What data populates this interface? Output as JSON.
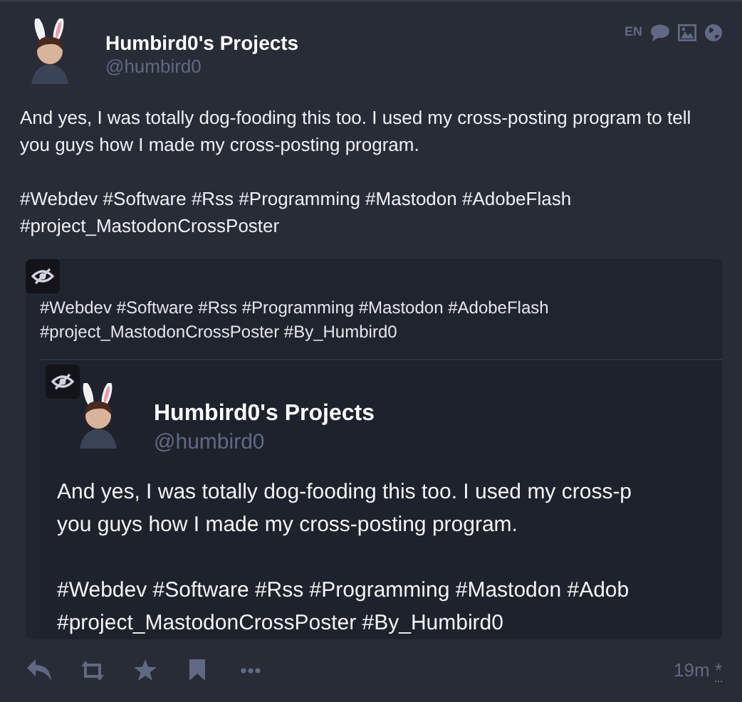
{
  "post": {
    "author": {
      "display_name": "Humbird0's Projects",
      "handle": "@humbird0"
    },
    "meta": {
      "language": "EN"
    },
    "body": [
      "And yes, I was totally dog-fooding this too. I used my cross-posting program to tell you guys how I made my cross-posting program.",
      "#Webdev #Software #Rss #Programming #Mastodon #AdobeFlash #project_MastodonCrossPoster"
    ],
    "attachment": {
      "kind": "screenshot",
      "lines": [
        "#Webdev #Software #Rss #Programming #Mastodon #AdobeFlash",
        "#project_MastodonCrossPoster #By_Humbird0"
      ],
      "embedded": {
        "display_name": "Humbird0's Projects",
        "handle": "@humbird0",
        "paragraphs": [
          [
            "And yes, I was totally dog-fooding this too. I used my cross-p",
            "you guys how I made my cross-posting program."
          ],
          [
            "#Webdev #Software #Rss #Programming #Mastodon #Adob",
            "#project_MastodonCrossPoster #By_Humbird0"
          ]
        ]
      }
    },
    "actions": [
      {
        "kind": "reply"
      },
      {
        "kind": "boost"
      },
      {
        "kind": "favourite"
      },
      {
        "kind": "bookmark"
      },
      {
        "kind": "more"
      }
    ],
    "timestamp": {
      "time": "19m",
      "edited_mark": "*"
    }
  }
}
